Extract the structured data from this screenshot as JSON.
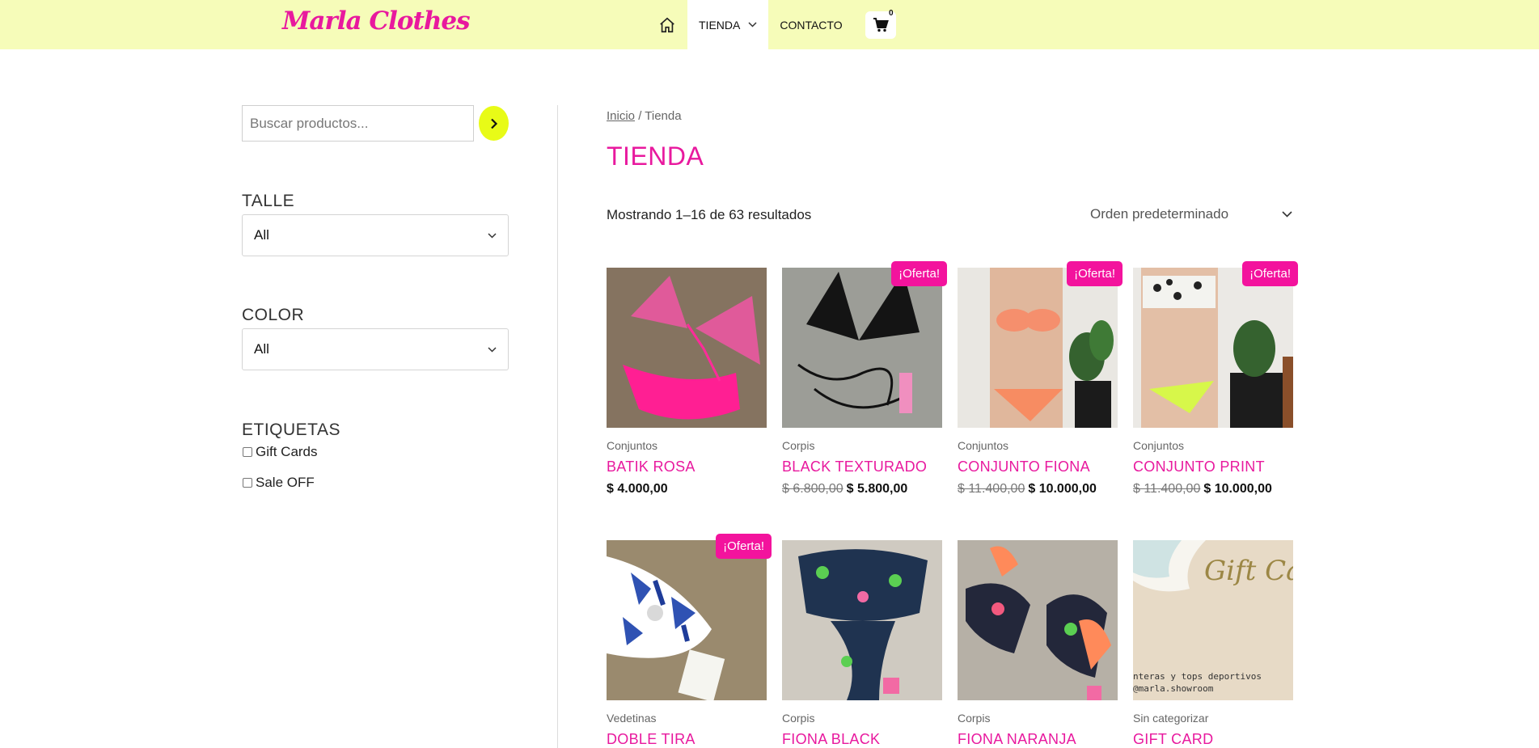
{
  "header": {
    "logo": "Marla Clothes",
    "nav": [
      {
        "label": "TIENDA",
        "icon": "chevron-down-icon"
      },
      {
        "label": "CONTACTO"
      }
    ],
    "home_icon": "home-icon",
    "cart_icon": "cart-icon",
    "cart_count": "0"
  },
  "sidebar": {
    "search_placeholder": "Buscar productos...",
    "search_button_icon": "chevron-right-icon",
    "size_title": "TALLE",
    "size_value": "All",
    "color_title": "COLOR",
    "color_value": "All",
    "tags_title": "ETIQUETAS",
    "tags": [
      "Gift Cards",
      "Sale OFF"
    ]
  },
  "main": {
    "breadcrumb_home": "Inicio",
    "breadcrumb_sep": " / ",
    "breadcrumb_current": "Tienda",
    "title": "TIENDA",
    "result_count": "Mostrando 1–16 de 63 resultados",
    "orderby": "Orden predeterminado",
    "sale_badge": "¡Oferta!",
    "products": [
      {
        "category": "Conjuntos",
        "name": "BATIK ROSA",
        "old_price": "",
        "price": "$ 4.000,00"
      },
      {
        "category": "Corpis",
        "name": "BLACK TEXTURADO",
        "old_price": "$ 6.800,00",
        "price": "$ 5.800,00"
      },
      {
        "category": "Conjuntos",
        "name": "CONJUNTO FIONA",
        "old_price": "$ 11.400,00",
        "price": "$ 10.000,00"
      },
      {
        "category": "Conjuntos",
        "name": "CONJUNTO PRINT",
        "old_price": "$ 11.400,00",
        "price": "$ 10.000,00"
      },
      {
        "category": "Vedetinas",
        "name": "DOBLE TIRA",
        "old_price": "",
        "price": ""
      },
      {
        "category": "Corpis",
        "name": "FIONA BLACK",
        "old_price": "",
        "price": ""
      },
      {
        "category": "Corpis",
        "name": "FIONA NARANJA",
        "old_price": "",
        "price": ""
      },
      {
        "category": "Sin categorizar",
        "name": "GIFT CARD",
        "old_price": "",
        "price": ""
      }
    ],
    "gift_card_image_text": "Gift Ca",
    "gift_card_image_caption1": "nteras y tops deportivos",
    "gift_card_image_caption2": "@marla.showroom"
  },
  "colors": {
    "header_bg": "#f6fcb9",
    "accent_pink": "#e8199e",
    "sale_badge": "#f3139d",
    "search_button": "#e8fb17"
  }
}
